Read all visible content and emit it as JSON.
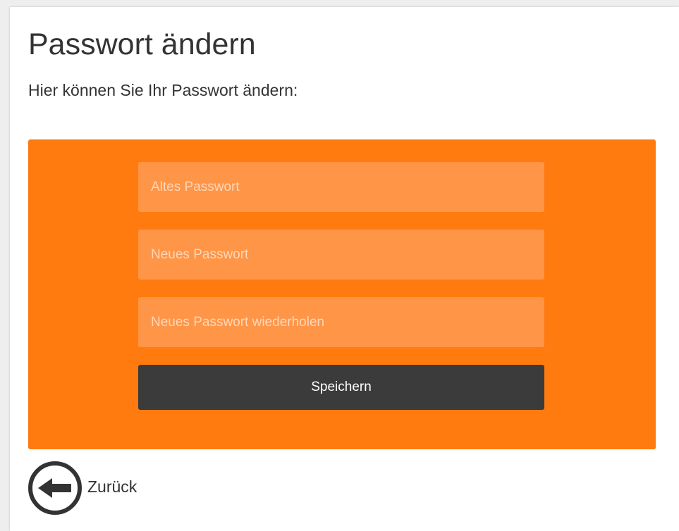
{
  "page": {
    "title": "Passwort ändern",
    "subtitle": "Hier können Sie Ihr Passwort ändern:"
  },
  "form": {
    "old_password": {
      "placeholder": "Altes Passwort",
      "value": ""
    },
    "new_password": {
      "placeholder": "Neues Passwort",
      "value": ""
    },
    "repeat_password": {
      "placeholder": "Neues Passwort wiederholen",
      "value": ""
    },
    "save_label": "Speichern"
  },
  "navigation": {
    "back_label": "Zurück",
    "back_icon": "arrow-left-circle-icon"
  },
  "colors": {
    "panel": "#ff7b0f",
    "field": "#ff9547",
    "button": "#3b3b3b",
    "text": "#333333"
  }
}
